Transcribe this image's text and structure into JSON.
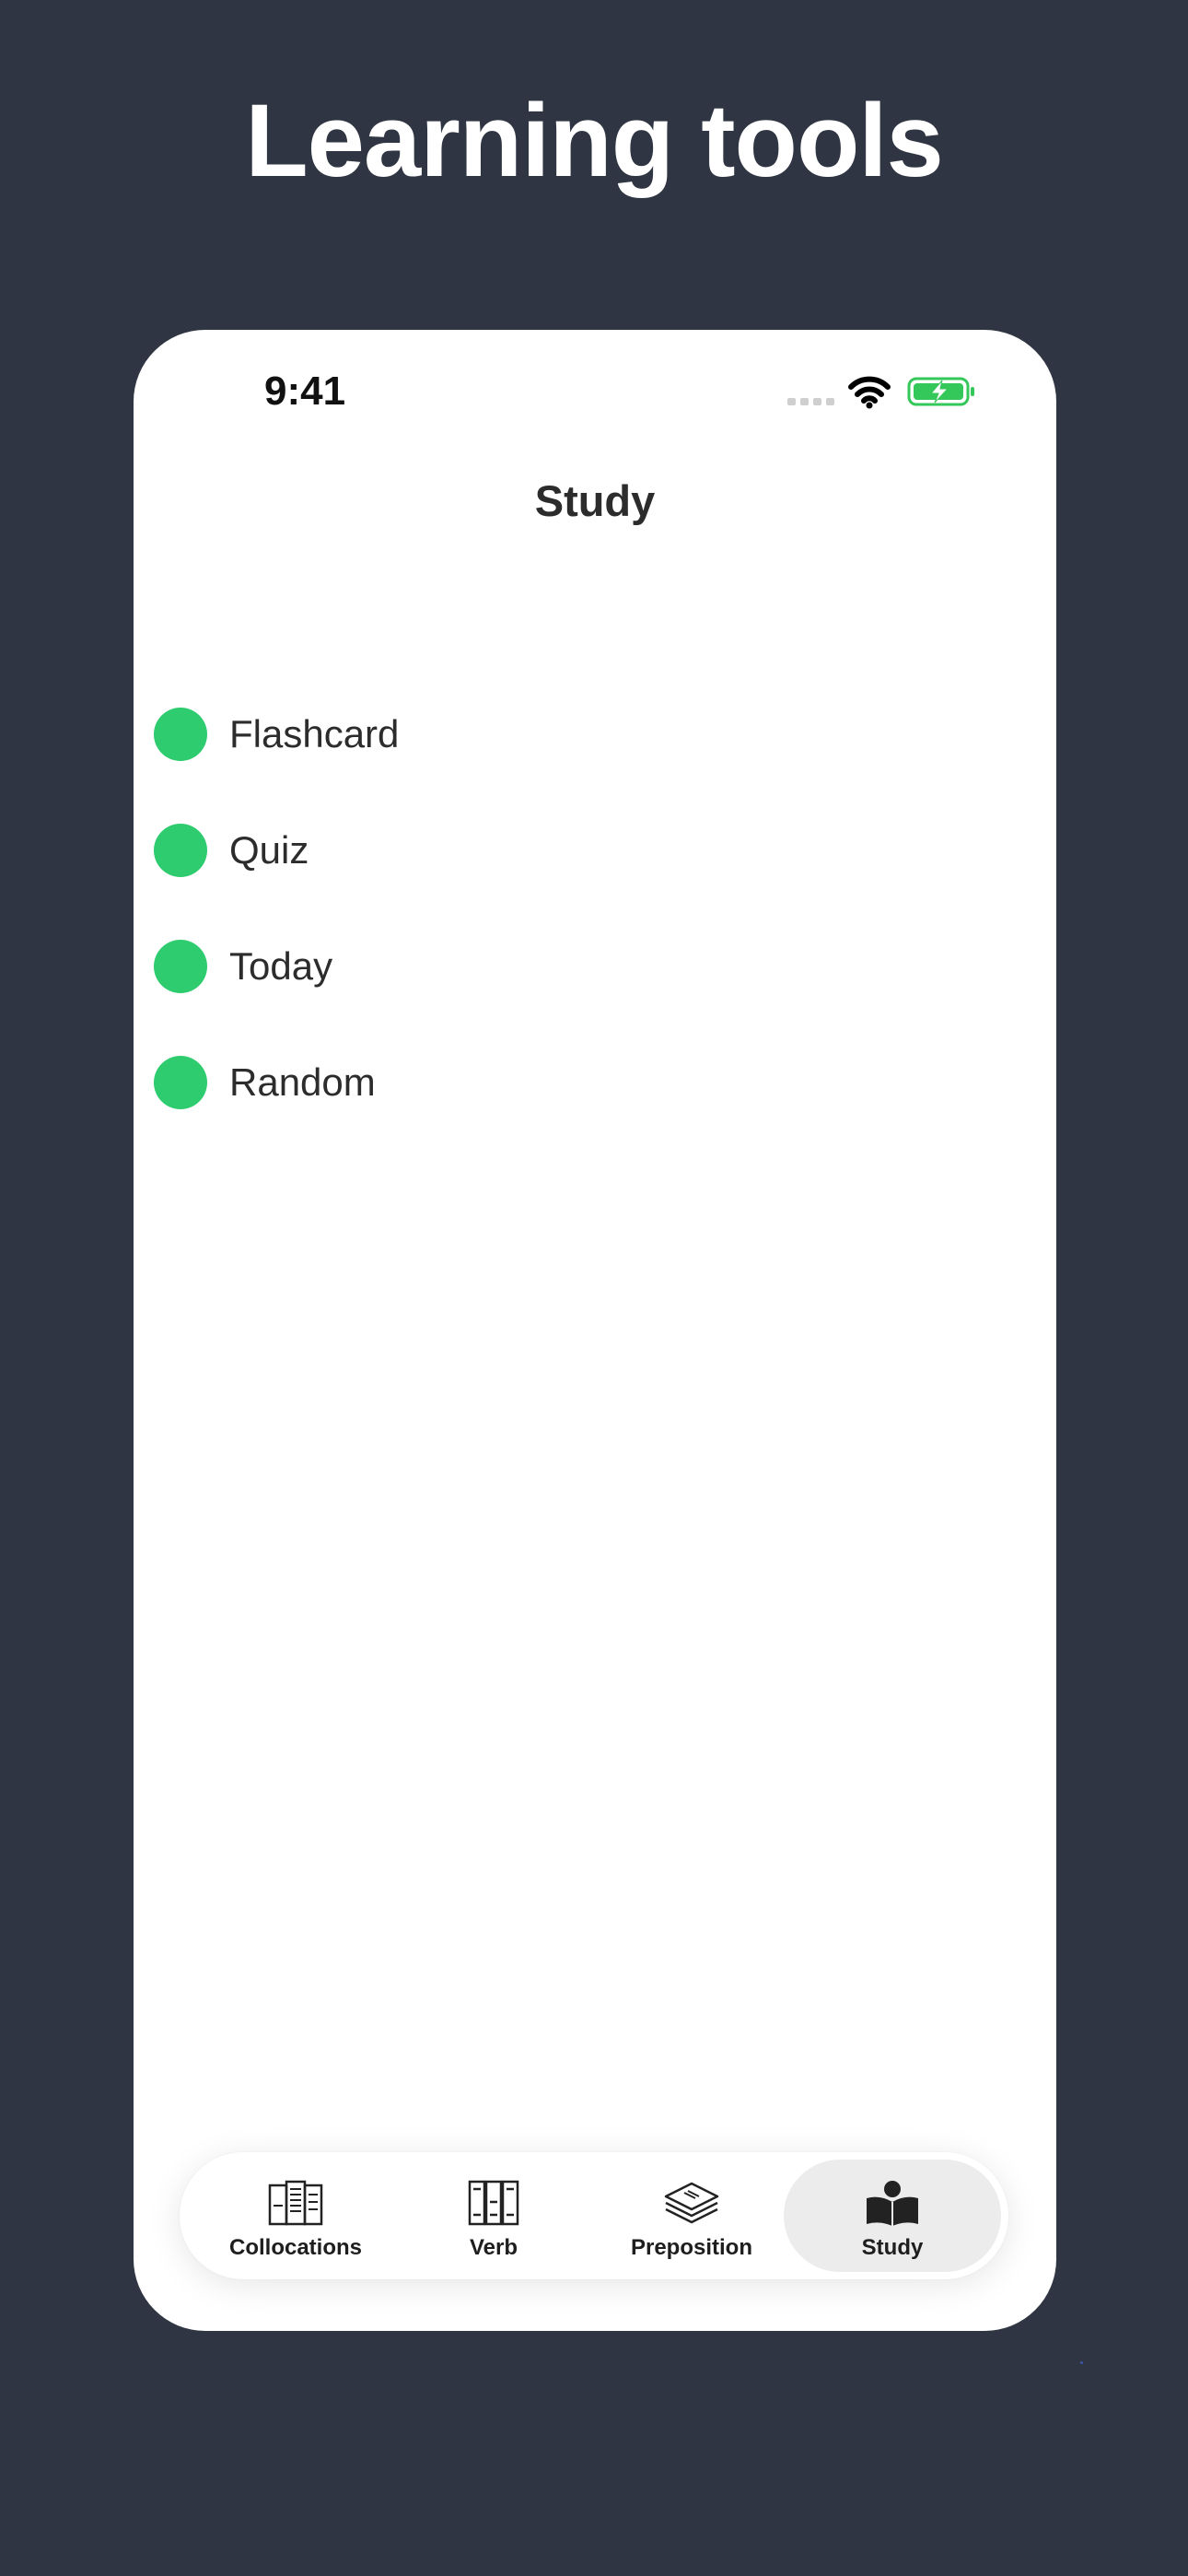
{
  "headline": "Learning tools",
  "status_bar": {
    "time": "9:41",
    "icons": [
      "cellular-signal-icon",
      "wifi-icon",
      "battery-charging-icon"
    ]
  },
  "screen": {
    "title": "Study"
  },
  "menu": {
    "items": [
      {
        "label": "Flashcard"
      },
      {
        "label": "Quiz"
      },
      {
        "label": "Today"
      },
      {
        "label": "Random"
      }
    ]
  },
  "tab_bar": {
    "tabs": [
      {
        "label": "Collocations",
        "icon": "collocations-book-icon",
        "active": false
      },
      {
        "label": "Verb",
        "icon": "books-shelf-icon",
        "active": false
      },
      {
        "label": "Preposition",
        "icon": "layers-stack-icon",
        "active": false
      },
      {
        "label": "Study",
        "icon": "reader-icon",
        "active": true
      }
    ]
  },
  "colors": {
    "background": "#2f3542",
    "accent_green": "#2ecc6f",
    "battery_green": "#34c759",
    "active_tab_bg": "#ececec"
  }
}
